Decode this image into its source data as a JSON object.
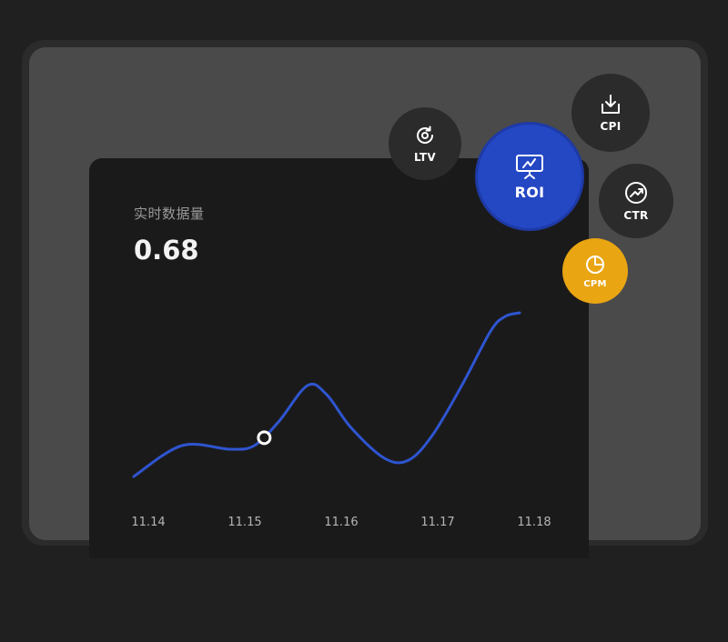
{
  "card": {
    "label": "实时数据量",
    "value": "0.68"
  },
  "buttons": {
    "ltv": "LTV",
    "cpi": "CPI",
    "roi": "ROI",
    "ctr": "CTR",
    "cpm": "CPM"
  },
  "colors": {
    "background": "#202020",
    "panel": "#4a4a4a",
    "card": "#1b1a1b",
    "accent_blue": "#2447c4",
    "accent_yellow": "#e9a512",
    "line": "#2e55d0"
  },
  "icons": {
    "ltv": "refresh-icon",
    "cpi": "download-icon",
    "roi": "presentation-chart-icon",
    "ctr": "trend-up-icon",
    "cpm": "pie-chart-icon"
  },
  "chart_data": {
    "type": "line",
    "categories": [
      "11.14",
      "11.15",
      "11.16",
      "11.17",
      "11.18"
    ],
    "x": [
      0,
      0.5,
      1.0,
      1.25,
      1.5,
      1.8,
      2.0,
      2.25,
      2.6,
      2.85,
      3.1,
      3.4,
      3.7,
      3.85,
      4.0
    ],
    "values": [
      0.05,
      0.22,
      0.2,
      0.22,
      0.35,
      0.55,
      0.5,
      0.32,
      0.15,
      0.14,
      0.28,
      0.55,
      0.85,
      0.93,
      0.95
    ],
    "highlight_x": 1.35,
    "ylim": [
      0,
      1
    ],
    "title": "",
    "xlabel": "",
    "ylabel": "",
    "grid": false
  }
}
